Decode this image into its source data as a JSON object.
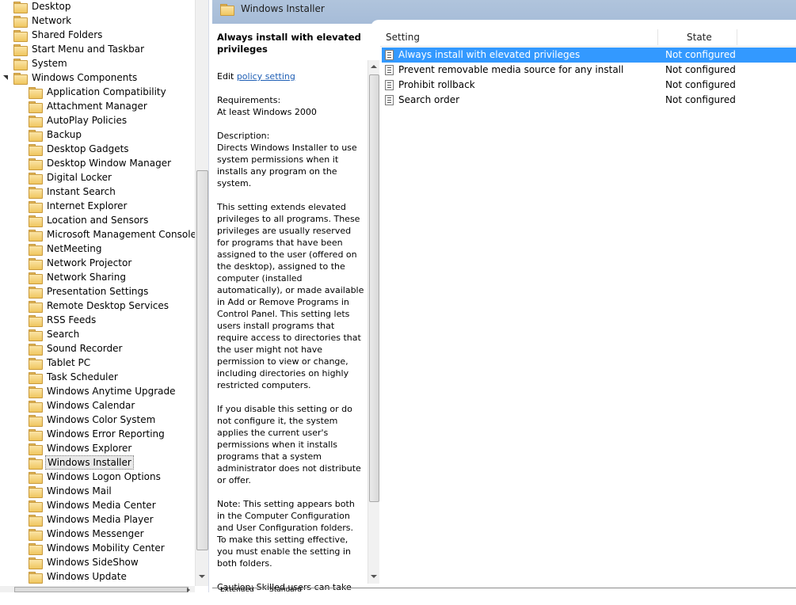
{
  "tree": {
    "items": [
      {
        "label": "Desktop",
        "expander": "collapsed",
        "indent": 0
      },
      {
        "label": "Network",
        "expander": "collapsed",
        "indent": 0
      },
      {
        "label": "Shared Folders",
        "expander": "none",
        "indent": 0
      },
      {
        "label": "Start Menu and Taskbar",
        "expander": "none",
        "indent": 0
      },
      {
        "label": "System",
        "expander": "collapsed",
        "indent": 0
      },
      {
        "label": "Windows Components",
        "expander": "expanded",
        "indent": 0
      },
      {
        "label": "Application Compatibility",
        "expander": "none",
        "indent": 1
      },
      {
        "label": "Attachment Manager",
        "expander": "none",
        "indent": 1
      },
      {
        "label": "AutoPlay Policies",
        "expander": "none",
        "indent": 1
      },
      {
        "label": "Backup",
        "expander": "collapsed",
        "indent": 1
      },
      {
        "label": "Desktop Gadgets",
        "expander": "none",
        "indent": 1
      },
      {
        "label": "Desktop Window Manager",
        "expander": "collapsed",
        "indent": 1
      },
      {
        "label": "Digital Locker",
        "expander": "none",
        "indent": 1
      },
      {
        "label": "Instant Search",
        "expander": "none",
        "indent": 1
      },
      {
        "label": "Internet Explorer",
        "expander": "collapsed",
        "indent": 1
      },
      {
        "label": "Location and Sensors",
        "expander": "none",
        "indent": 1
      },
      {
        "label": "Microsoft Management Console",
        "expander": "collapsed",
        "indent": 1
      },
      {
        "label": "NetMeeting",
        "expander": "collapsed",
        "indent": 1
      },
      {
        "label": "Network Projector",
        "expander": "none",
        "indent": 1
      },
      {
        "label": "Network Sharing",
        "expander": "none",
        "indent": 1
      },
      {
        "label": "Presentation Settings",
        "expander": "none",
        "indent": 1
      },
      {
        "label": "Remote Desktop Services",
        "expander": "collapsed",
        "indent": 1
      },
      {
        "label": "RSS Feeds",
        "expander": "none",
        "indent": 1
      },
      {
        "label": "Search",
        "expander": "none",
        "indent": 1
      },
      {
        "label": "Sound Recorder",
        "expander": "none",
        "indent": 1
      },
      {
        "label": "Tablet PC",
        "expander": "collapsed",
        "indent": 1
      },
      {
        "label": "Task Scheduler",
        "expander": "none",
        "indent": 1
      },
      {
        "label": "Windows Anytime Upgrade",
        "expander": "none",
        "indent": 1
      },
      {
        "label": "Windows Calendar",
        "expander": "none",
        "indent": 1
      },
      {
        "label": "Windows Color System",
        "expander": "none",
        "indent": 1
      },
      {
        "label": "Windows Error Reporting",
        "expander": "collapsed",
        "indent": 1
      },
      {
        "label": "Windows Explorer",
        "expander": "collapsed",
        "indent": 1
      },
      {
        "label": "Windows Installer",
        "expander": "none",
        "indent": 1,
        "selected": true
      },
      {
        "label": "Windows Logon Options",
        "expander": "none",
        "indent": 1
      },
      {
        "label": "Windows Mail",
        "expander": "none",
        "indent": 1
      },
      {
        "label": "Windows Media Center",
        "expander": "none",
        "indent": 1
      },
      {
        "label": "Windows Media Player",
        "expander": "collapsed",
        "indent": 1
      },
      {
        "label": "Windows Messenger",
        "expander": "none",
        "indent": 1
      },
      {
        "label": "Windows Mobility Center",
        "expander": "none",
        "indent": 1
      },
      {
        "label": "Windows SideShow",
        "expander": "none",
        "indent": 1
      },
      {
        "label": "Windows Update",
        "expander": "none",
        "indent": 1
      }
    ]
  },
  "header": {
    "title": "Windows Installer",
    "folder_icon": "folder-icon"
  },
  "description": {
    "title": "Always install with elevated privileges",
    "edit_prefix": "Edit ",
    "edit_link": "policy setting",
    "requirements_label": "Requirements:",
    "requirements_value": "At least Windows 2000",
    "description_label": "Description:",
    "paragraph_1": "Directs Windows Installer to use system permissions when it installs any program on the system.",
    "paragraph_2": "This setting extends elevated privileges to all programs. These privileges are usually reserved for programs that have been assigned to the user (offered on the desktop), assigned to the computer (installed automatically), or made available in Add or Remove Programs in Control Panel. This setting lets users install programs that require access to directories that the user might not have permission to view or change, including directories on highly restricted computers.",
    "paragraph_3": "If you disable this setting or do not configure it, the system applies the current user's permissions when it installs programs that a system administrator does not distribute or offer.",
    "paragraph_4": "Note: This setting appears both in the Computer Configuration and User Configuration folders. To make this setting effective, you must enable the setting in both folders.",
    "paragraph_5": "Caution: Skilled users can take"
  },
  "list": {
    "columns": {
      "setting": "Setting",
      "state": "State"
    },
    "rows": [
      {
        "setting": "Always install with elevated privileges",
        "state": "Not configured",
        "selected": true
      },
      {
        "setting": "Prevent removable media source for any install",
        "state": "Not configured",
        "selected": false
      },
      {
        "setting": "Prohibit rollback",
        "state": "Not configured",
        "selected": false
      },
      {
        "setting": "Search order",
        "state": "Not configured",
        "selected": false
      }
    ]
  },
  "bottom_tabs": {
    "extended": "Extended",
    "standard": "Standard"
  },
  "colors": {
    "selection": "#3399ff",
    "header_band": "#a6bcd8",
    "link": "#1f5fb5"
  }
}
